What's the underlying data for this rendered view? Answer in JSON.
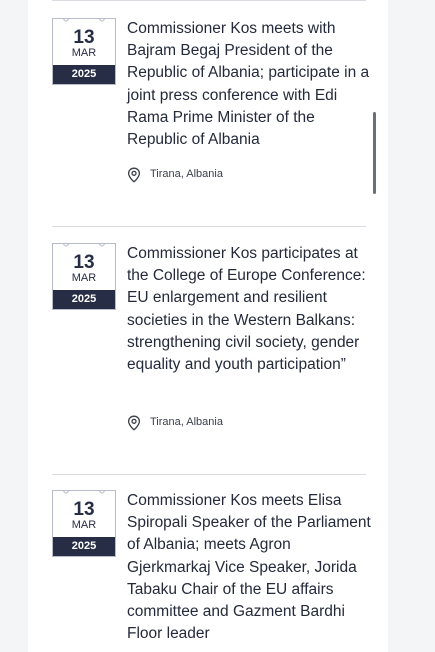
{
  "events": [
    {
      "day": "13",
      "month": "MAR",
      "year": "2025",
      "title": "Commissioner Kos meets with Bajram Begaj President of the Republic of Albania; participate in a joint press conference with Edi Rama Prime Minister of the Republic of Albania",
      "location": "Tirana, Albania"
    },
    {
      "day": "13",
      "month": "MAR",
      "year": "2025",
      "title": "Commissioner Kos participates at the College of Europe Conference: EU enlargement and resilient societies in the Western Balkans: strengthening civil society, gender equality and youth participation”",
      "location": "Tirana, Albania"
    },
    {
      "day": "13",
      "month": "MAR",
      "year": "2025",
      "title": "Commissioner Kos meets Elisa Spiropali Speaker of the Parliament of Albania; meets Agron Gjerkmarkaj Vice Speaker, Jorida Tabaku Chair of the EU affairs committee and Gazment Bardhi Floor leader",
      "location": ""
    }
  ],
  "colors": {
    "navy": "#262d45",
    "text": "#242a3a",
    "divider": "#d8dbe0"
  },
  "icons": {
    "location": "location-pin-icon"
  }
}
